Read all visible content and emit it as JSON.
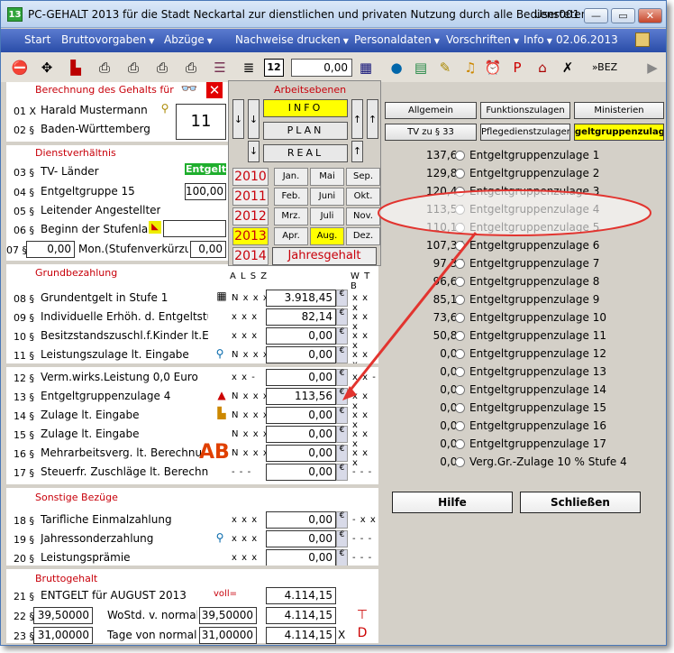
{
  "window": {
    "app_icon": "13",
    "title": "PC-GEHALT 2013 für die Stadt Neckartal zur dienstlichen und privaten Nutzung durch alle Bediensteten.",
    "user": "User001",
    "minimize": "—",
    "maximize": "▭",
    "close": "✕"
  },
  "menu": {
    "items": [
      "Start",
      "Bruttovorgaben",
      "Abzüge",
      "Nachweise drucken",
      "Personaldaten",
      "Vorschriften",
      "Info"
    ],
    "date": "02.06.2013"
  },
  "toolbar": {
    "value": "0,00",
    "kbd_label": "12",
    "right_text": "»BEZ"
  },
  "left": {
    "sec1": {
      "header": "Berechnung des Gehalts für",
      "rows": [
        {
          "num": "01 X",
          "label": "Harald Mustermann"
        },
        {
          "num": "02 §",
          "label": "Baden-Württemberg"
        }
      ],
      "spinner": "11"
    },
    "sec2": {
      "header": "Dienstverhältnis",
      "rows": [
        {
          "num": "03 §",
          "label": "TV- Länder",
          "badge": "EntgeltO"
        },
        {
          "num": "04 §",
          "label": "Entgeltgruppe 15",
          "value": "100,00"
        },
        {
          "num": "05 §",
          "label": "Leitender Angestellter"
        },
        {
          "num": "06 §",
          "label": "Beginn der Stufenlauf"
        },
        {
          "num": "07 §",
          "label": "Mon.(Stufenverkürzur",
          "value_a": "0,00",
          "value_b": "0,00"
        }
      ]
    },
    "sec3": {
      "header": "Grundbezahlung",
      "colhdr1": "A L S Z",
      "colhdr2": "W T B",
      "rows": [
        {
          "num": "08 §",
          "label": "Grundentgelt in Stufe 1",
          "flags": "N x x x",
          "value": "3.918,45",
          "wtb": "x x x"
        },
        {
          "num": "09 §",
          "label": "Individuelle Erhöh. d. Entgeltstufe",
          "flags": "x x x",
          "value": "82,14",
          "wtb": "x x x"
        },
        {
          "num": "10 §",
          "label": "Besitzstandszuschl.f.Kinder lt.Ein",
          "flags": "x x x",
          "value": "0,00",
          "wtb": "x x x"
        },
        {
          "num": "11 §",
          "label": "Leistungszulage lt. Eingabe",
          "flags": "N x x x",
          "value": "0,00",
          "wtb": "x x x"
        }
      ]
    },
    "sec4": {
      "rows": [
        {
          "num": "12 §",
          "label": "Verm.wirks.Leistung   0,0 Euro",
          "flags": "x x -",
          "value": "0,00",
          "wtb": "x x -"
        },
        {
          "num": "13 §",
          "label": "Entgeltgruppenzulage 4",
          "flags": "N x x x",
          "value": "113,56",
          "wtb": "x x x"
        },
        {
          "num": "14 §",
          "label": "Zulage lt. Eingabe",
          "flags": "N x x x",
          "value": "0,00",
          "wtb": "x x x"
        },
        {
          "num": "15 §",
          "label": "Zulage lt. Eingabe",
          "flags": "N x x x",
          "value": "0,00",
          "wtb": "x x x"
        },
        {
          "num": "16 §",
          "label": "Mehrarbeitsverg. lt. Berechnu",
          "flags": "N x x x",
          "value": "0,00",
          "wtb": "x x x"
        },
        {
          "num": "17 §",
          "label": "Steuerfr. Zuschläge lt. Berechn",
          "flags": "- - -",
          "value": "0,00",
          "wtb": "- - -"
        }
      ]
    },
    "sec5": {
      "header": "Sonstige Bezüge",
      "rows": [
        {
          "num": "18 §",
          "label": "Tarifliche Einmalzahlung",
          "flags": "x x x",
          "value": "0,00",
          "wtb": "- x x"
        },
        {
          "num": "19 §",
          "label": "Jahressonderzahlung",
          "flags": "x x x",
          "value": "0,00",
          "wtb": "- - -"
        },
        {
          "num": "20 §",
          "label": "Leistungsprämie",
          "flags": "x x x",
          "value": "0,00",
          "wtb": "- - -"
        }
      ]
    },
    "sec6": {
      "header": "Bruttogehalt",
      "row21": {
        "num": "21 §",
        "label": "ENTGELT für AUGUST  2013",
        "tag": "voll=",
        "value": "4.114,15"
      },
      "row22": {
        "num": "22 §",
        "input": "39,50000",
        "label": "WoStd. v. normal",
        "value_a": "39,50000",
        "value": "4.114,15"
      },
      "row23": {
        "num": "23 §",
        "input": "31,00000",
        "label": "Tage von normal",
        "value_a": "31,00000",
        "value": "4.114,15",
        "mark": "X"
      }
    }
  },
  "arbeit": {
    "header": "Arbeitsebenen",
    "info": "INFO",
    "plan": "PLAN",
    "real": "REAL",
    "years": [
      "2010",
      "2011",
      "2012",
      "2013",
      "2014"
    ],
    "months": [
      [
        "Jan.",
        "Mai",
        "Sep."
      ],
      [
        "Feb.",
        "Juni",
        "Okt."
      ],
      [
        "Mrz.",
        "Juli",
        "Nov."
      ],
      [
        "Apr.",
        "Aug.",
        "Dez."
      ]
    ],
    "jahres": "Jahresgehalt"
  },
  "right": {
    "tabs": [
      "Allgemein",
      "Funktionszulagen",
      "Ministerien",
      "TV zu § 33",
      "Pflegedienstzulagen",
      "geltgruppenzulag"
    ],
    "rows": [
      {
        "value": "137,61",
        "label": "Entgeltgruppenzulage 1"
      },
      {
        "value": "129,80",
        "label": "Entgeltgruppenzulage 2"
      },
      {
        "value": "120,41",
        "label": "Entgeltgruppenzulage 3"
      },
      {
        "value": "113,56",
        "label": "Entgeltgruppenzulage 4"
      },
      {
        "value": "110,18",
        "label": "Entgeltgruppenzulage 5"
      },
      {
        "value": "107,36",
        "label": "Entgeltgruppenzulage 6"
      },
      {
        "value": "97,36",
        "label": "Entgeltgruppenzulage 7"
      },
      {
        "value": "96,63",
        "label": "Entgeltgruppenzulage 8"
      },
      {
        "value": "85,18",
        "label": "Entgeltgruppenzulage 9"
      },
      {
        "value": "73,62",
        "label": "Entgeltgruppenzulage 10"
      },
      {
        "value": "50,83",
        "label": "Entgeltgruppenzulage 11"
      },
      {
        "value": "0,00",
        "label": "Entgeltgruppenzulage 12"
      },
      {
        "value": "0,00",
        "label": "Entgeltgruppenzulage 13"
      },
      {
        "value": "0,00",
        "label": "Entgeltgruppenzulage 14"
      },
      {
        "value": "0,00",
        "label": "Entgeltgruppenzulage 15"
      },
      {
        "value": "0,00",
        "label": "Entgeltgruppenzulage 16"
      },
      {
        "value": "0,00",
        "label": "Entgeltgruppenzulage 17"
      },
      {
        "value": "0,00",
        "label": "Verg.Gr.-Zulage 10 % Stufe 4"
      }
    ],
    "hilfe": "Hilfe",
    "schliessen": "Schließen"
  },
  "colors": {
    "accent_red": "#c8000a",
    "menubar": "#2a4da8",
    "active_yellow": "#ffff00",
    "highlight_green": "#1fae2d"
  }
}
